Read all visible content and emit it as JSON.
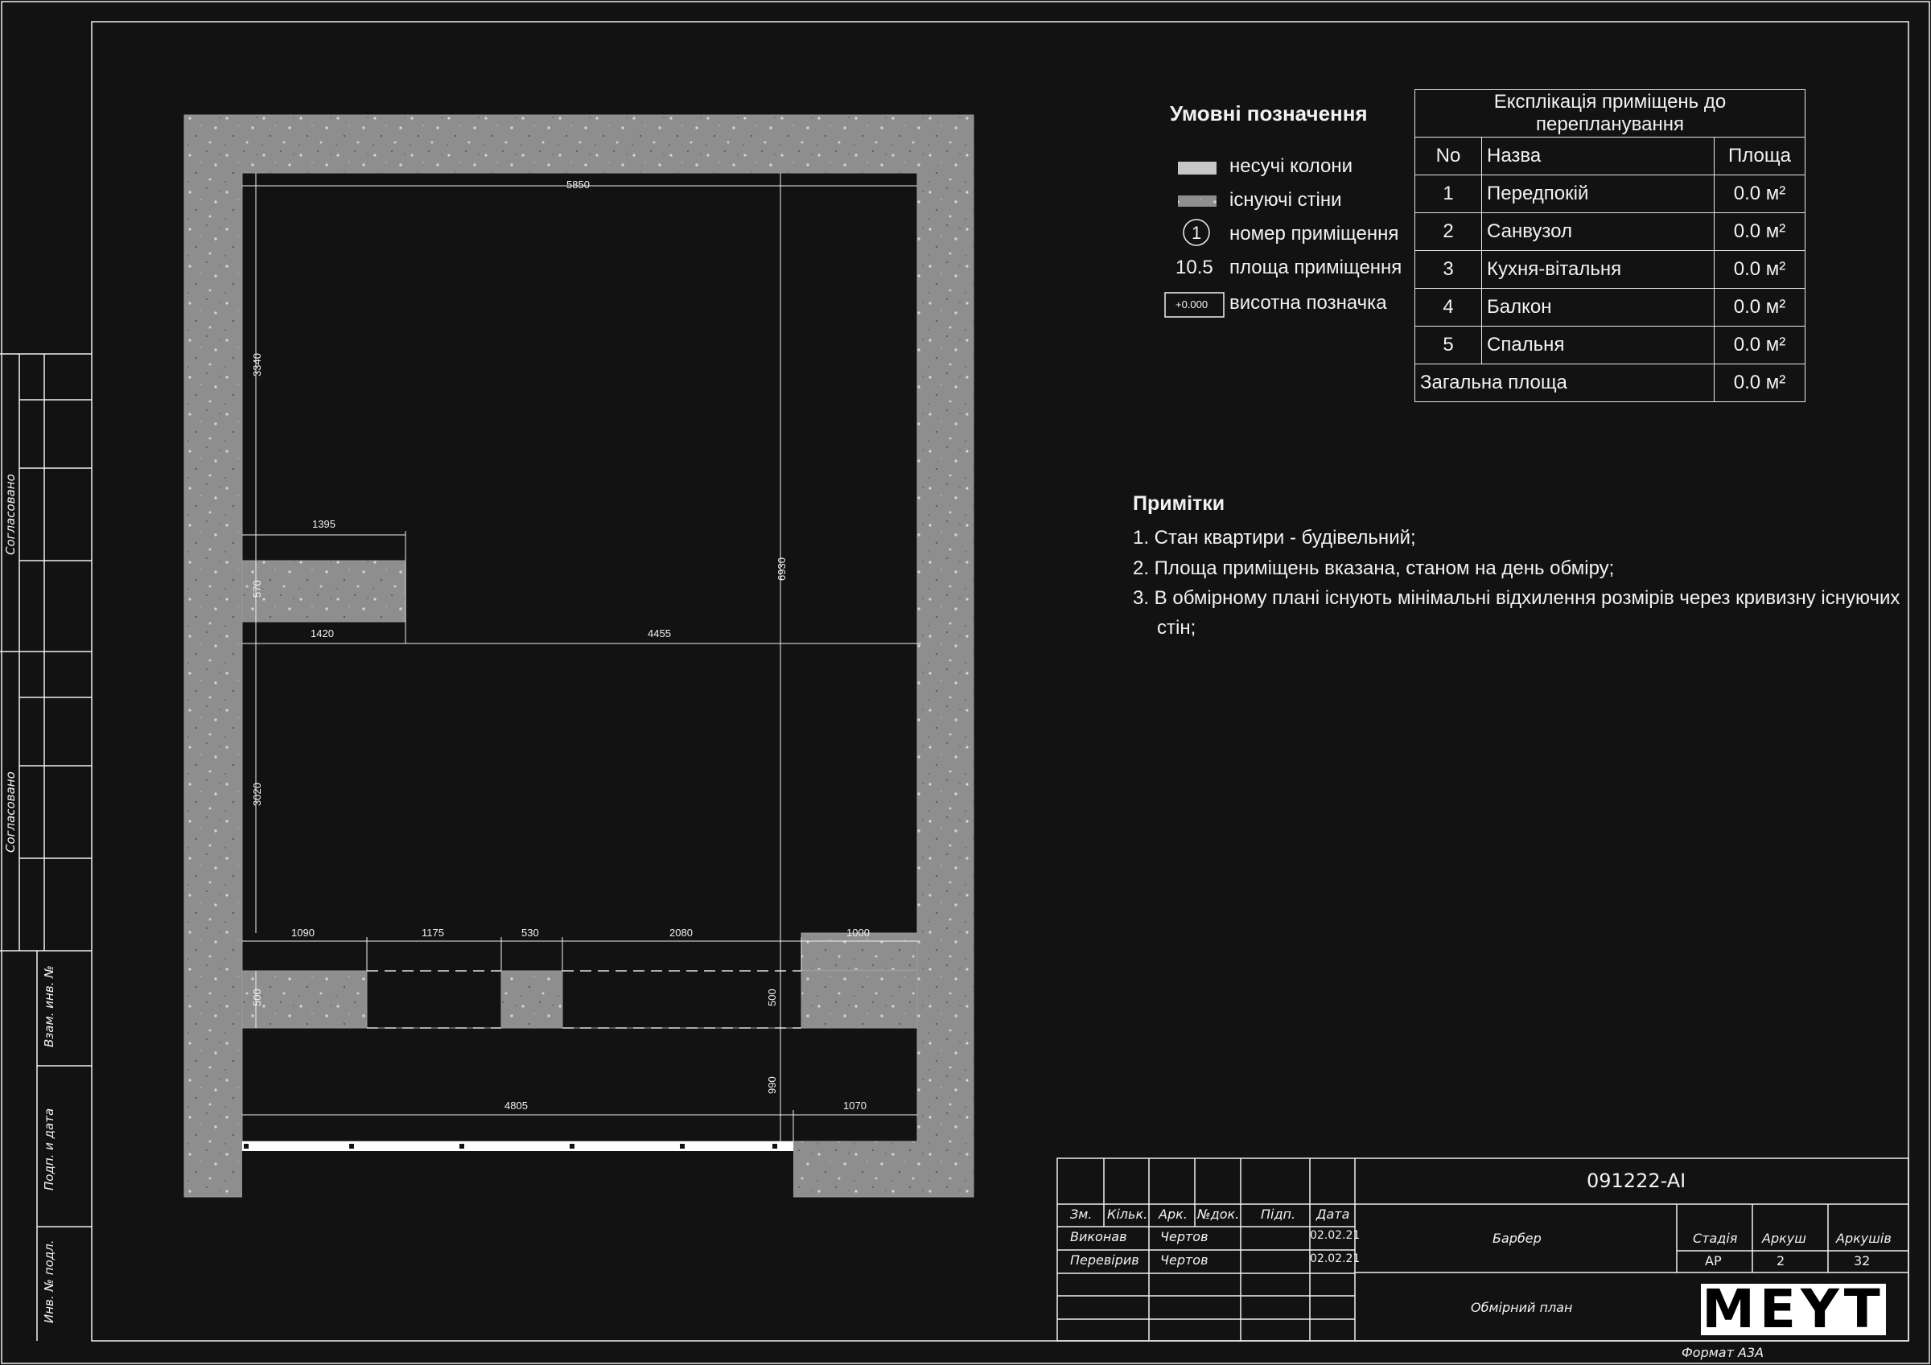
{
  "legend": {
    "title": "Умовні позначення",
    "items": [
      {
        "label": "несучі колони"
      },
      {
        "label": "існуючі стіни"
      },
      {
        "symbol": "1",
        "label": "номер приміщення"
      },
      {
        "symbol": "10.5",
        "label": "площа приміщення"
      },
      {
        "symbol": "+0.000",
        "label": "висотна позначка"
      }
    ]
  },
  "explication": {
    "title": "Експлікація приміщень до перепланування",
    "headers": [
      "No",
      "Назва",
      "Площа"
    ],
    "rows": [
      {
        "no": "1",
        "name": "Передпокій",
        "area": "0.0 м²"
      },
      {
        "no": "2",
        "name": "Санвузол",
        "area": "0.0 м²"
      },
      {
        "no": "3",
        "name": "Кухня-вітальня",
        "area": "0.0 м²"
      },
      {
        "no": "4",
        "name": "Балкон",
        "area": "0.0 м²"
      },
      {
        "no": "5",
        "name": "Спальня",
        "area": "0.0 м²"
      }
    ],
    "total_label": "Загальна площа",
    "total_area": "0.0 м²"
  },
  "notes": {
    "title": "Примітки",
    "items": [
      "1.  Стан квартири - будівельний;",
      "2.  Площа приміщень вказана, станом на день обміру;",
      "3.  В обмірному плані існують мінімальні відхилення розмірів через кривизну існуючих",
      "стін;"
    ]
  },
  "dimensions": {
    "top": "5850",
    "left_upper": "3340",
    "ledge_width": "1395",
    "ledge_height": "570",
    "left_mid": "1420",
    "mid_right": "4455",
    "total_height": "6930",
    "left_lower": "3020",
    "seg1": "1090",
    "seg2": "1175",
    "seg3": "530",
    "seg4": "2080",
    "seg5": "1000",
    "wall_left": "500",
    "wall_right": "500",
    "bottom_left": "4805",
    "bottom_right": "1070",
    "bottom_height": "990"
  },
  "title_block": {
    "code": "091222-AI",
    "col_headers": [
      "Зм.",
      "Кільк.",
      "Арк.",
      "№док.",
      "Підп.",
      "Дата"
    ],
    "rows": [
      {
        "role": "Виконав",
        "name": "Чертов",
        "date": "02.02.21"
      },
      {
        "role": "Перевірив",
        "name": "Чертов",
        "date": "02.02.21"
      }
    ],
    "project": "Барбер",
    "sheet_title": "Обмірний план",
    "stage_header": "Стадія",
    "sheet_header": "Аркуш",
    "sheets_header": "Аркушів",
    "stage": "АР",
    "sheet": "2",
    "sheets": "32",
    "logo": "MEYT",
    "format": "Формат А3А"
  },
  "side_labels": {
    "agreed_1": "Согласовано",
    "agreed_2": "Согласовано",
    "inv_replace": "Взам. инв. №",
    "sign_date": "Подп. и дата",
    "inv_orig": "Инв. № подл."
  },
  "colors": {
    "background": "#121212",
    "concrete": "#8e8e8e",
    "line": "#f0f0f0"
  }
}
